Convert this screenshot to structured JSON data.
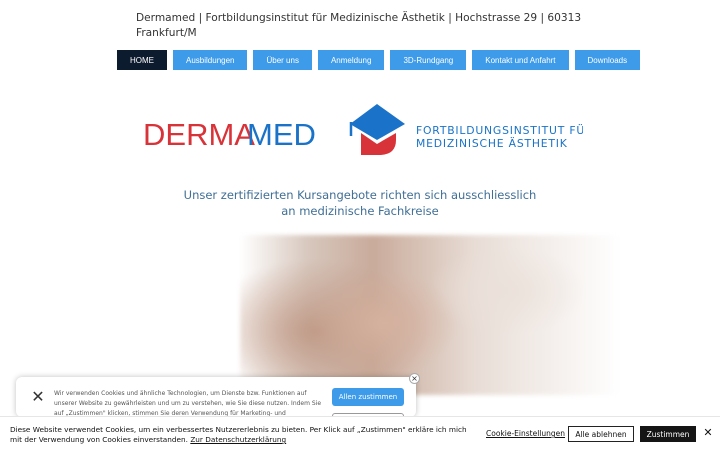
{
  "header": {
    "text": "Dermamed | Fortbildungsinstitut für Medizinische Ästhetik  | Hochstrasse 29  | 60313 Frankfurt/M"
  },
  "nav": {
    "items": [
      {
        "label": "HOME",
        "active": true
      },
      {
        "label": "Ausbildungen",
        "active": false
      },
      {
        "label": "Über uns",
        "active": false
      },
      {
        "label": "Anmeldung",
        "active": false
      },
      {
        "label": "3D-Rundgang",
        "active": false
      },
      {
        "label": "Kontakt und Anfahrt",
        "active": false
      },
      {
        "label": "Downloads",
        "active": false
      }
    ]
  },
  "logo": {
    "word_part1": "DERMA",
    "word_part2": "MED",
    "subtitle_line1": "FORTBILDUNGSINSTITUT FÜR",
    "subtitle_line2": "MEDIZINISCHE ÄSTHETIK",
    "colors": {
      "red": "#d9333a",
      "blue": "#1a73c8"
    }
  },
  "tagline": {
    "line1": "Unser zertifizierten Kursangebote richten sich ausschliesslich",
    "line2": "an medizinische Fachkreise"
  },
  "cookie_popup": {
    "text": "Wir verwenden Cookies und ähnliche Technologien, um Dienste bzw. Funktionen auf unserer Website zu gewährleisten und um zu verstehen, wie Sie diese nutzen. Indem Sie auf „Zustimmen\" klicken, stimmen Sie deren Verwendung für Marketing- und",
    "accept_all_label": "Allen zustimmen"
  },
  "cookie_bar": {
    "text": "Diese Website verwendet Cookies, um ein verbessertes Nutzererlebnis zu bieten. Per Klick auf „Zustimmen\" erkläre ich mich mit der Verwendung von Cookies einverstanden.",
    "privacy_link": "Zur Datenschutzerklärung",
    "settings_label": "Cookie-Einstellungen",
    "reject_label": "Alle ablehnen",
    "accept_label": "Zustimmen"
  },
  "colors": {
    "nav_blue": "#3d9be9",
    "nav_active": "#0d1b2e",
    "tagline": "#3f6f96"
  }
}
